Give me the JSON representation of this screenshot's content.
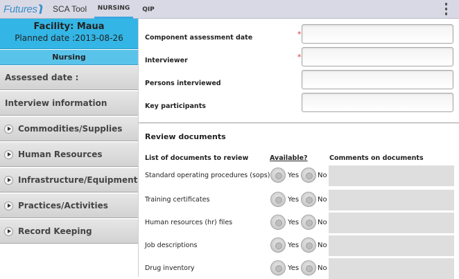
{
  "topbar": {
    "logo_text": "Futures",
    "app_title": "SCA Tool",
    "tabs": [
      {
        "label": "NURSING",
        "active": true
      },
      {
        "label": "QIP",
        "active": false
      }
    ],
    "overflow_icon": "vertical-ellipsis-icon"
  },
  "colors": {
    "accent_blue": "#33b5e5",
    "tab_underline": "#3ba7e0",
    "required_star": "#e03030"
  },
  "sidebar": {
    "facility_name": "Facility: Maua",
    "planned_date": "Planned date :2013-08-26",
    "section_label": "Nursing",
    "items": [
      {
        "label": "Assessed date :",
        "has_arrow": false
      },
      {
        "label": "Interview information",
        "has_arrow": false
      },
      {
        "label": "Commodities/Supplies",
        "has_arrow": true,
        "icon": "chevron-right-circle-icon"
      },
      {
        "label": "Human Resources",
        "has_arrow": true,
        "icon": "chevron-right-circle-icon"
      },
      {
        "label": "Infrastructure/Equipment",
        "has_arrow": true,
        "icon": "chevron-right-circle-icon"
      },
      {
        "label": "Practices/Activities",
        "has_arrow": true,
        "icon": "chevron-right-circle-icon"
      },
      {
        "label": "Record Keeping",
        "has_arrow": true,
        "icon": "chevron-right-circle-icon"
      }
    ]
  },
  "form": {
    "fields": [
      {
        "label": "Component assessment date",
        "required": true,
        "value": ""
      },
      {
        "label": "Interviewer",
        "required": true,
        "value": ""
      },
      {
        "label": "Persons interviewed",
        "required": false,
        "value": ""
      },
      {
        "label": "Key participants",
        "required": false,
        "value": ""
      }
    ],
    "required_mark": "*"
  },
  "review": {
    "title": "Review documents",
    "columns": {
      "documents": "List of documents to review",
      "available": "Available?",
      "comments": "Comments on documents"
    },
    "yes_label": "Yes",
    "no_label": "No",
    "rows": [
      {
        "name": "Standard operating procedures (sops)"
      },
      {
        "name": "Training certificates"
      },
      {
        "name": "Human resources (hr) files"
      },
      {
        "name": "Job descriptions"
      },
      {
        "name": "Drug inventory"
      }
    ]
  }
}
